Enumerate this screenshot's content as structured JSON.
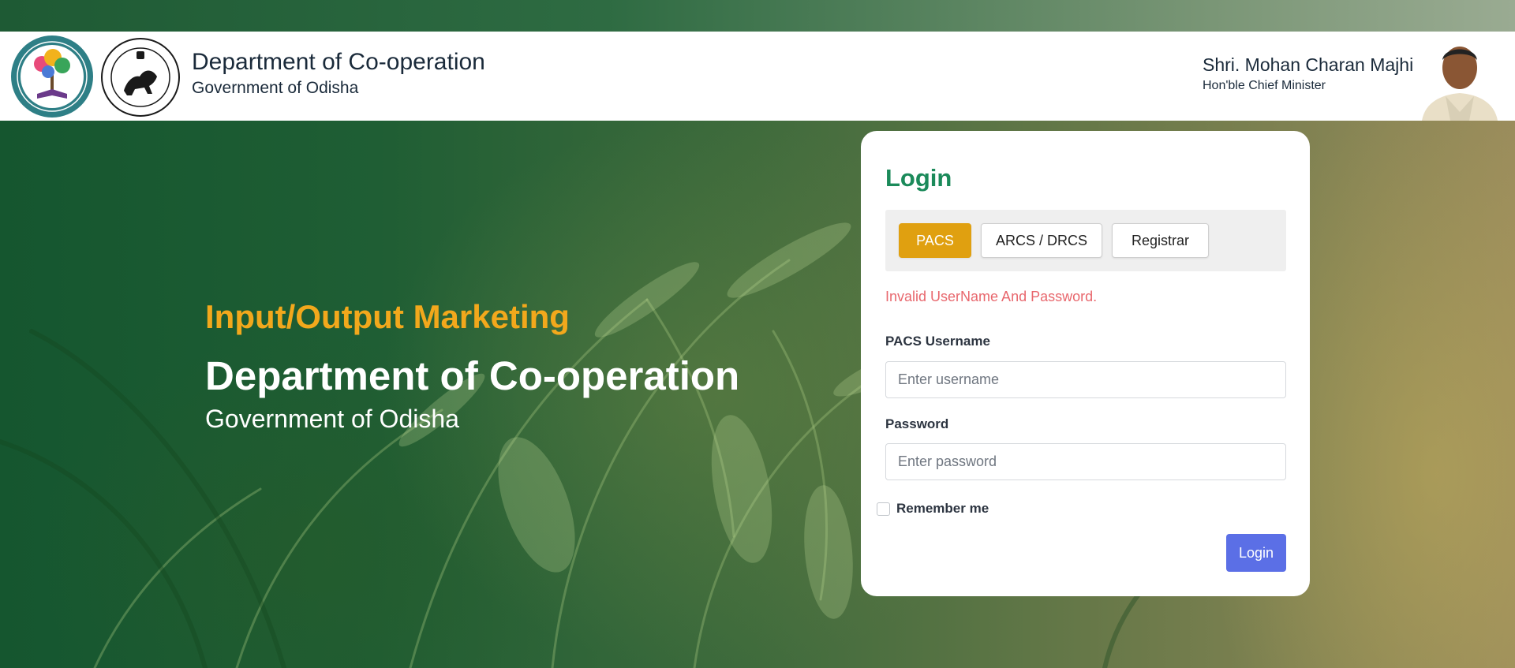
{
  "header": {
    "title": "Department of Co-operation",
    "subtitle": "Government of Odisha",
    "cm_name": "Shri. Mohan Charan Majhi",
    "cm_title": "Hon'ble Chief Minister"
  },
  "hero": {
    "kicker": "Input/Output Marketing",
    "title": "Department of Co-operation",
    "subtitle": "Government of Odisha"
  },
  "login": {
    "title": "Login",
    "tabs": [
      {
        "label": "PACS",
        "active": true
      },
      {
        "label": "ARCS / DRCS",
        "active": false
      },
      {
        "label": "Registrar",
        "active": false
      }
    ],
    "error": "Invalid UserName And Password.",
    "username_label": "PACS Username",
    "username_placeholder": "Enter username",
    "password_label": "Password",
    "password_placeholder": "Enter password",
    "remember_label": "Remember me",
    "submit_label": "Login"
  },
  "colors": {
    "accent_orange": "#e0a010",
    "heading_green": "#1b8a5a",
    "error_red": "#e8676d",
    "button_blue": "#5b6fe6"
  }
}
